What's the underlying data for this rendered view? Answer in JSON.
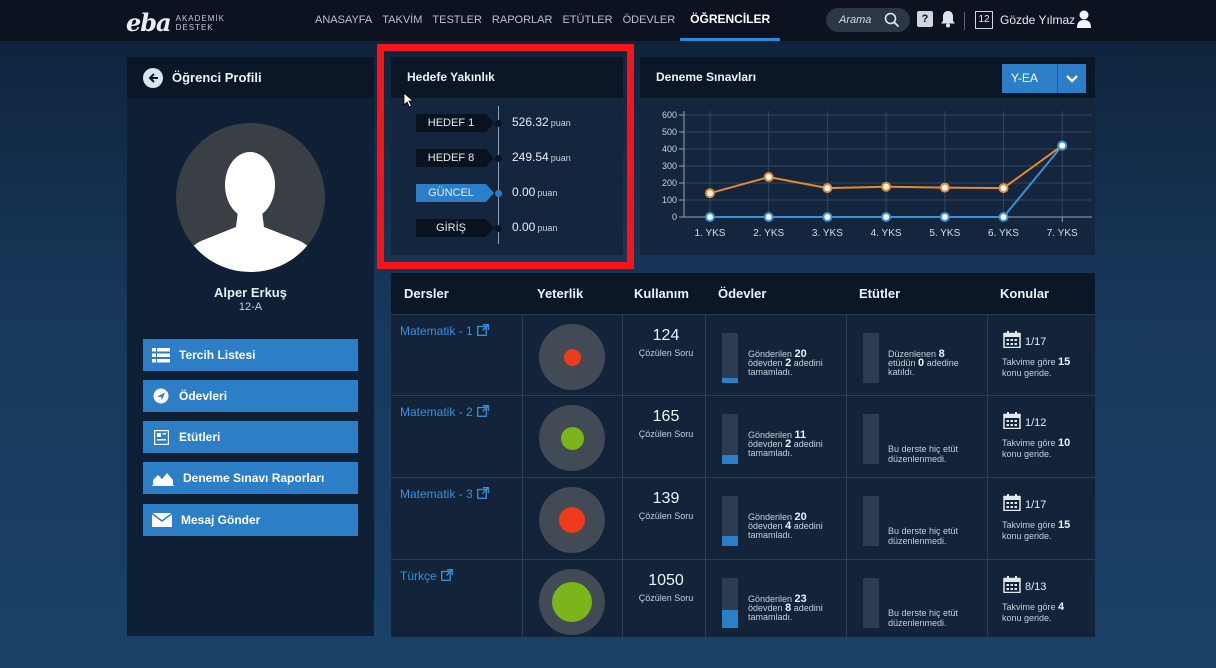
{
  "brand": {
    "logo": "eba",
    "sub_line1": "AKADEMİK",
    "sub_line2": "DESTEK"
  },
  "nav": [
    {
      "label": "ANASAYFA"
    },
    {
      "label": "TAKVİM"
    },
    {
      "label": "TESTLER"
    },
    {
      "label": "RAPORLAR"
    },
    {
      "label": "ETÜTLER"
    },
    {
      "label": "ÖDEVLER"
    },
    {
      "label": "ÖĞRENCİLER",
      "active": true
    }
  ],
  "search": {
    "placeholder": "Arama"
  },
  "header": {
    "help": "?",
    "calendar_day": "12",
    "user_name": "Gözde Yılmaz"
  },
  "profile": {
    "title": "Öğrenci Profili",
    "name": "Alper Erkuş",
    "class": "12-A",
    "menu": [
      {
        "label": "Tercih Listesi",
        "icon": "list-icon"
      },
      {
        "label": "Ödevleri",
        "icon": "send-icon"
      },
      {
        "label": "Etütleri",
        "icon": "board-icon"
      },
      {
        "label": "Deneme Sınavı Raporları",
        "icon": "area-chart-icon"
      },
      {
        "label": "Mesaj Gönder",
        "icon": "envelope-icon"
      }
    ]
  },
  "hedef": {
    "title": "Hedefe Yakınlık",
    "unit": "puan",
    "rows": [
      {
        "label": "HEDEF 1",
        "value": "526.32"
      },
      {
        "label": "HEDEF 8",
        "value": "249.54"
      },
      {
        "label": "GÜNCEL",
        "value": "0.00",
        "current": true
      },
      {
        "label": "GİRİŞ",
        "value": "0.00"
      }
    ]
  },
  "deneme": {
    "title": "Deneme Sınavları",
    "selected": "Y-EA"
  },
  "chart_data": {
    "type": "line",
    "categories": [
      "1. YKS",
      "2. YKS",
      "3. YKS",
      "4. YKS",
      "5. YKS",
      "6. YKS",
      "7. YKS"
    ],
    "ylim": [
      0,
      600
    ],
    "yticks": [
      0,
      100,
      200,
      300,
      400,
      500,
      600
    ],
    "grid": true,
    "series": [
      {
        "color": "#e8892e",
        "values": [
          140,
          235,
          170,
          178,
          173,
          170,
          420
        ]
      },
      {
        "color": "#3f8fd6",
        "values": [
          0,
          0,
          0,
          0,
          0,
          0,
          420
        ]
      }
    ]
  },
  "table": {
    "headers": [
      "Dersler",
      "Yeterlik",
      "Kullanım",
      "Ödevler",
      "Etütler",
      "Konular"
    ],
    "count_label": "Çözülen Soru",
    "rows": [
      {
        "course": "Matematik - 1",
        "dot_color": "#ee3b1c",
        "level": 0.18,
        "count": "124",
        "hw_pre": "Gönderilen",
        "hw_total": "20",
        "hw_mid": "ödevden",
        "hw_done": "2",
        "hw_post": "adedini tamamladı.",
        "hw_ratio": 0.1,
        "etut_pre": "Düzenlenen",
        "etut_total": "8",
        "etut_mid": "etüdün",
        "etut_done": "0",
        "etut_post": "adedine katıldı.",
        "etut_ratio": 0,
        "konu": "1/17",
        "konu_pre": "Takvime göre",
        "konu_num": "15",
        "konu_post": "konu geride."
      },
      {
        "course": "Matematik - 2",
        "dot_color": "#7bb51b",
        "level": 0.3,
        "count": "165",
        "hw_pre": "Gönderilen",
        "hw_total": "11",
        "hw_mid": "ödevden",
        "hw_done": "2",
        "hw_post": "adedini tamamladı.",
        "hw_ratio": 0.18,
        "etut_none": "Bu derste hiç etüt düzenlenmedi.",
        "etut_ratio": 0,
        "konu": "1/12",
        "konu_pre": "Takvime göre",
        "konu_num": "10",
        "konu_post": "konu geride."
      },
      {
        "course": "Matematik - 3",
        "dot_color": "#ee3b1c",
        "level": 0.36,
        "count": "139",
        "hw_pre": "Gönderilen",
        "hw_total": "20",
        "hw_mid": "ödevden",
        "hw_done": "4",
        "hw_post": "adedini tamamladı.",
        "hw_ratio": 0.2,
        "etut_none": "Bu derste hiç etüt düzenlenmedi.",
        "etut_ratio": 0,
        "konu": "1/17",
        "konu_pre": "Takvime göre",
        "konu_num": "15",
        "konu_post": "konu geride."
      },
      {
        "course": "Türkçe",
        "dot_color": "#7bb51b",
        "level": 0.64,
        "count": "1050",
        "hw_pre": "Gönderilen",
        "hw_total": "23",
        "hw_mid": "ödevden",
        "hw_done": "8",
        "hw_post": "adedini tamamladı.",
        "hw_ratio": 0.35,
        "etut_none": "Bu derste hiç etüt düzenlenmedi.",
        "etut_ratio": 0,
        "konu": "8/13",
        "konu_pre": "Takvime göre",
        "konu_num": "4",
        "konu_post": "konu geride."
      }
    ]
  }
}
